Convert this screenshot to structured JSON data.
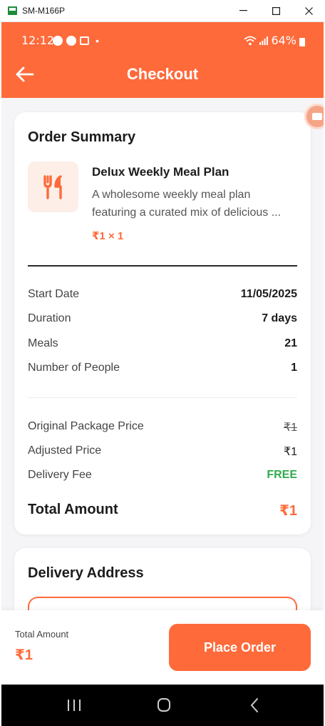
{
  "window": {
    "title": "SM-M166P"
  },
  "status_bar": {
    "time": "12:12",
    "battery": "64%",
    "dot": "•"
  },
  "header": {
    "title": "Checkout"
  },
  "order_summary": {
    "title": "Order Summary",
    "item": {
      "name": "Delux Weekly Meal Plan",
      "description_line1": "A wholesome weekly meal plan",
      "description_line2": "featuring a curated mix of delicious ...",
      "price_qty": "₹1 × 1",
      "icon": "utensils-icon"
    },
    "details": [
      {
        "label": "Start Date",
        "value": "11/05/2025"
      },
      {
        "label": "Duration",
        "value": "7 days"
      },
      {
        "label": "Meals",
        "value": "21"
      },
      {
        "label": "Number of People",
        "value": "1"
      }
    ],
    "pricing": {
      "original_label": "Original Package Price",
      "original_value": "₹1",
      "adjusted_label": "Adjusted Price",
      "adjusted_value": "₹1",
      "delivery_label": "Delivery Fee",
      "delivery_value": "FREE",
      "total_label": "Total Amount",
      "total_value": "₹1"
    }
  },
  "delivery_address": {
    "title": "Delivery Address"
  },
  "bottom_bar": {
    "total_label": "Total Amount",
    "total_value": "₹1",
    "button": "Place Order"
  },
  "colors": {
    "accent": "#fe6a3a",
    "free": "#2eaa4f"
  }
}
